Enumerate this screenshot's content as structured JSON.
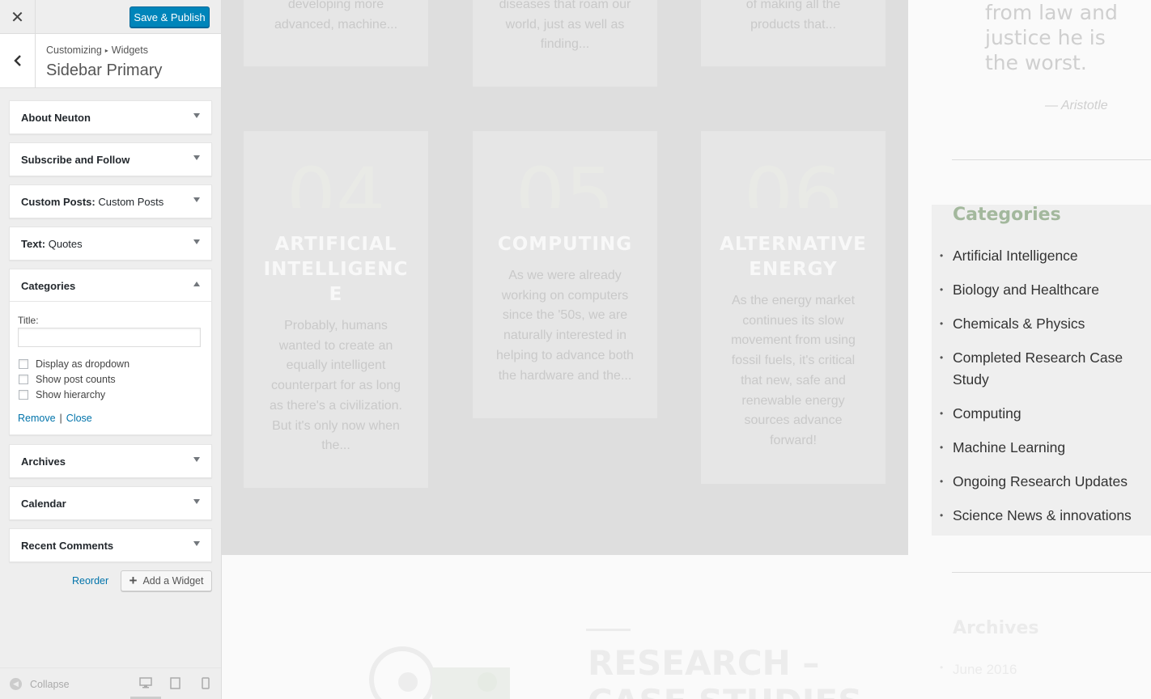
{
  "customizer": {
    "close_icon": "✕",
    "save_label": "Save & Publish",
    "breadcrumb": {
      "root": "Customizing",
      "sep": "▸",
      "leaf": "Widgets"
    },
    "section_title": "Sidebar Primary",
    "widgets": [
      {
        "name": "About Neuton",
        "sub": ""
      },
      {
        "name": "Subscribe and Follow",
        "sub": ""
      },
      {
        "name": "Custom Posts:",
        "sub": " Custom Posts"
      },
      {
        "name": "Text:",
        "sub": " Quotes"
      },
      {
        "name": "Categories",
        "sub": ""
      },
      {
        "name": "Archives",
        "sub": ""
      },
      {
        "name": "Calendar",
        "sub": ""
      },
      {
        "name": "Recent Comments",
        "sub": ""
      }
    ],
    "categories_form": {
      "title_label": "Title:",
      "title_value": "",
      "options": [
        "Display as dropdown",
        "Show post counts",
        "Show hierarchy"
      ],
      "remove": "Remove",
      "pipe": "|",
      "close": "Close"
    },
    "reorder": "Reorder",
    "add_widget": "Add a Widget",
    "collapse": "Collapse"
  },
  "preview": {
    "top_cards": [
      {
        "lines": [
          "developing more",
          "advanced, machine..."
        ]
      },
      {
        "lines": [
          "diseases that roam our",
          "world, just as well as",
          "finding..."
        ]
      },
      {
        "lines": [
          "of making all the",
          "products that..."
        ]
      }
    ],
    "cards": [
      {
        "num": "04",
        "title": [
          "ARTIFICIAL",
          "INTELLIGENC",
          "E"
        ],
        "text": [
          "Probably, humans",
          "wanted to create an",
          "equally intelligent",
          "counterpart for as long",
          "as there's a civilization.",
          "But it's only now when",
          "the..."
        ]
      },
      {
        "num": "05",
        "title": [
          "COMPUTING"
        ],
        "text": [
          "As we were already",
          "working on computers",
          "since the '50s, we are",
          "naturally interested in",
          "helping to advance both",
          "the hardware and the..."
        ]
      },
      {
        "num": "06",
        "title": [
          "ALTERNATIVE",
          "ENERGY"
        ],
        "text": [
          "As the energy market",
          "continues its slow",
          "movement from using",
          "fossil fuels, it's critical",
          "that new, safe and",
          "renewable energy",
          "sources advance",
          "forward!"
        ]
      }
    ],
    "quote_lines": [
      "from law and",
      "justice he is",
      "the worst."
    ],
    "quote_author": "— Aristotle",
    "categories_heading": "Categories",
    "categories": [
      "Artificial Intelligence",
      "Biology and Healthcare",
      "Chemicals & Physics",
      "Completed Research Case Study",
      "Computing",
      "Machine Learning",
      "Ongoing Research Updates",
      "Science News & innovations"
    ],
    "archives_heading": "Archives",
    "archives_item": "June 2016",
    "research_title_line1": "RESEARCH –",
    "research_title_line2": "CASE STUDIES"
  }
}
